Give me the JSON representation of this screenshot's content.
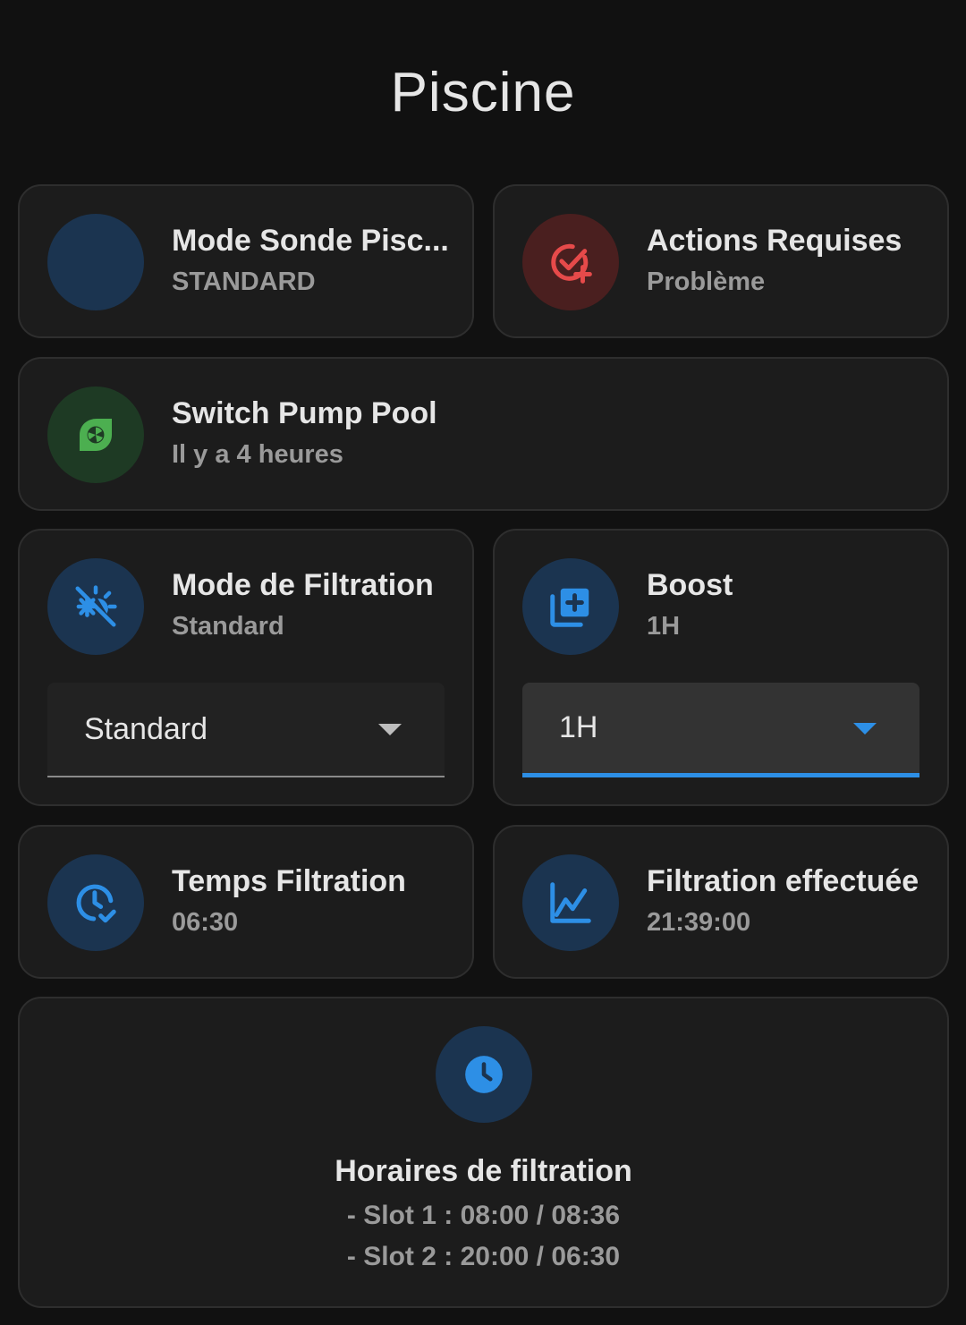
{
  "page": {
    "title": "Piscine"
  },
  "colors": {
    "background": "#111111",
    "card": "#1c1c1c",
    "accent_blue": "#2d8fe6",
    "accent_red": "#e64a4a",
    "accent_green": "#4caf50"
  },
  "tiles": {
    "mode_sonde": {
      "name": "Mode Sonde Pisc...",
      "state": "STANDARD",
      "icon": "blank-circle-icon"
    },
    "actions_requises": {
      "name": "Actions Requises",
      "state": "Problème",
      "icon": "check-plus-icon"
    },
    "switch_pump": {
      "name": "Switch Pump Pool",
      "state": "Il y a 4 heures",
      "icon": "pump-icon"
    },
    "mode_filtration": {
      "name": "Mode de Filtration",
      "state": "Standard",
      "icon": "sun-snowflake-icon",
      "select_value": "Standard"
    },
    "boost": {
      "name": "Boost",
      "state": "1H",
      "icon": "plus-box-multiple-icon",
      "select_value": "1H"
    },
    "temps_filtration": {
      "name": "Temps Filtration",
      "state": "06:30",
      "icon": "clock-check-icon"
    },
    "filtration_effectuee": {
      "name": "Filtration effectuée",
      "state": "21:39:00",
      "icon": "chart-line-icon"
    }
  },
  "schedule": {
    "title": "Horaires de filtration",
    "lines": [
      "- Slot 1 : 08:00 / 08:36",
      "- Slot 2 : 20:00 / 06:30"
    ],
    "icon": "clock-icon"
  }
}
